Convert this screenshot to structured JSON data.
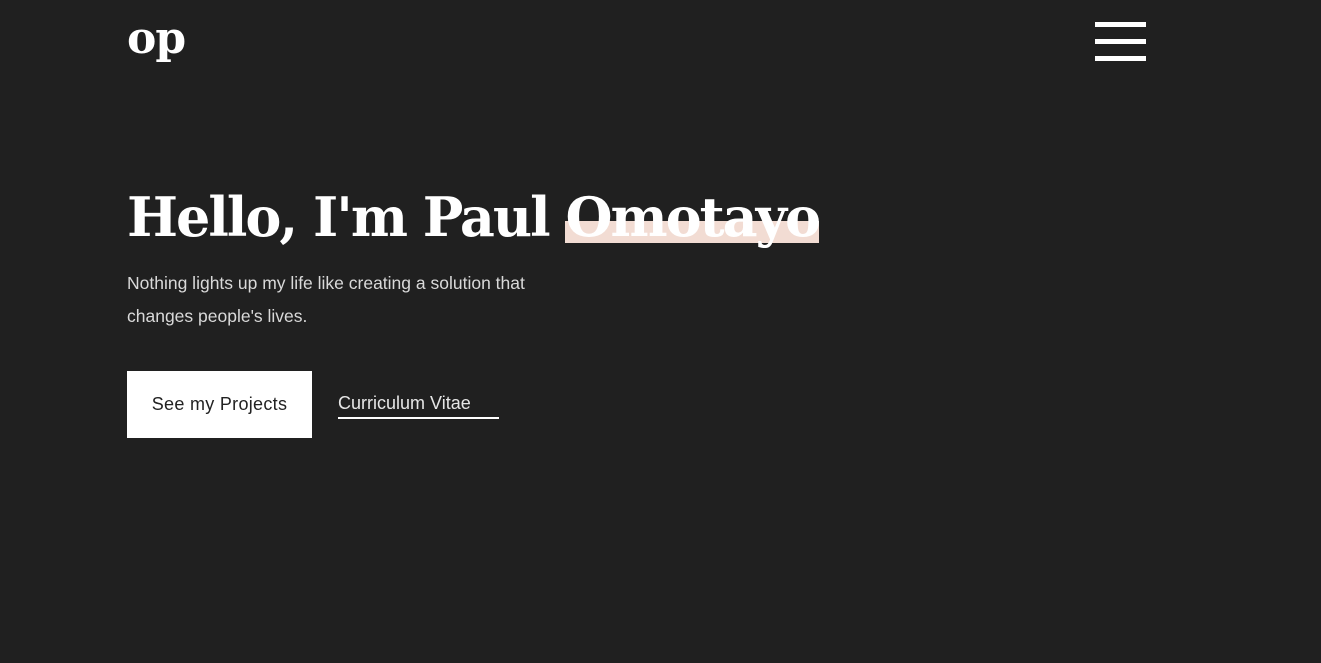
{
  "header": {
    "logo_text": "op",
    "menu_icon": "hamburger-menu-icon"
  },
  "hero": {
    "greeting": "Hello, I'm Paul ",
    "highlighted_name": "Omotayo",
    "tagline": "Nothing lights up my life like creating a solution that changes people's lives.",
    "primary_button_label": "See my Projects",
    "secondary_link_label": "Curriculum Vitae"
  },
  "colors": {
    "background": "#202020",
    "text": "#ffffff",
    "highlight": "#f2dcd3",
    "button_background": "#ffffff",
    "button_text": "#222222"
  }
}
